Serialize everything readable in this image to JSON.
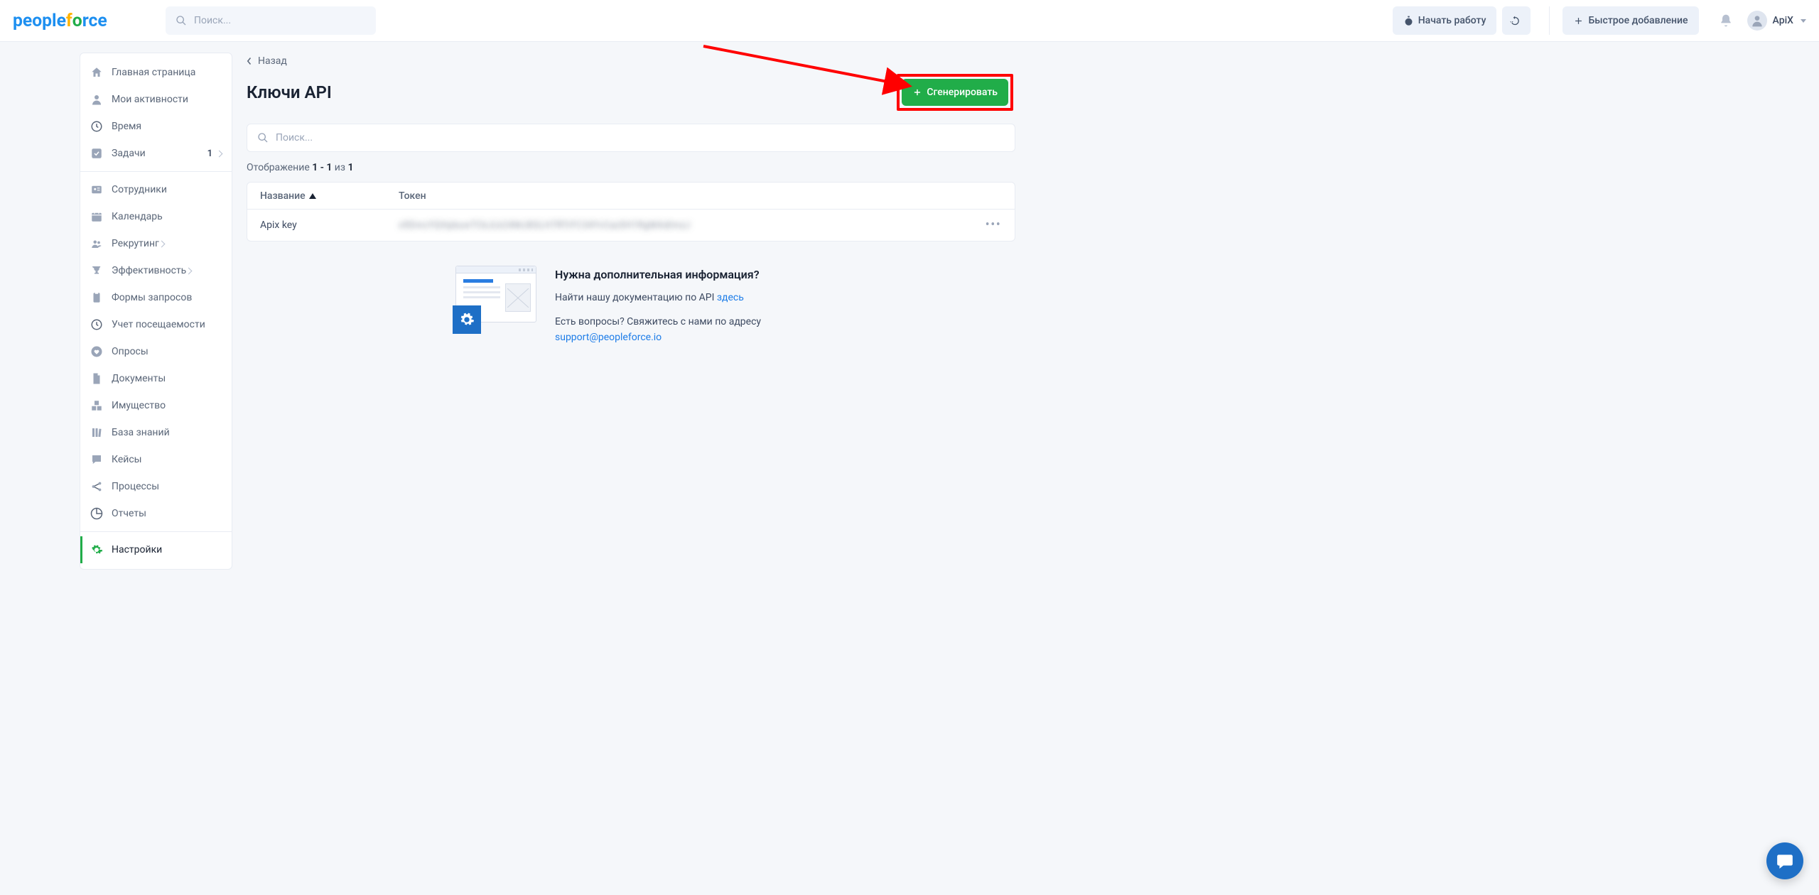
{
  "header": {
    "search_placeholder": "Поиск...",
    "start_label": "Начать работу",
    "quickadd_label": "Быстрое добавление",
    "username": "ApiX"
  },
  "sidebar": {
    "items": [
      {
        "label": "Главная страница",
        "icon": "home"
      },
      {
        "label": "Мои активности",
        "icon": "user"
      },
      {
        "label": "Время",
        "icon": "clock"
      },
      {
        "label": "Задачи",
        "icon": "check",
        "badge": "1",
        "chev": true
      },
      {
        "hr": true
      },
      {
        "label": "Сотрудники",
        "icon": "idcard"
      },
      {
        "label": "Календарь",
        "icon": "calendar"
      },
      {
        "label": "Рекрутинг",
        "icon": "people",
        "chev": true
      },
      {
        "label": "Эффективность",
        "icon": "trophy",
        "chev": true
      },
      {
        "label": "Формы запросов",
        "icon": "clip"
      },
      {
        "label": "Учет посещаемости",
        "icon": "clock"
      },
      {
        "label": "Опросы",
        "icon": "heart"
      },
      {
        "label": "Документы",
        "icon": "doc"
      },
      {
        "label": "Имущество",
        "icon": "boxes"
      },
      {
        "label": "База знаний",
        "icon": "books"
      },
      {
        "label": "Кейсы",
        "icon": "chat"
      },
      {
        "label": "Процессы",
        "icon": "share"
      },
      {
        "label": "Отчеты",
        "icon": "pie"
      },
      {
        "hr": true
      },
      {
        "label": "Настройки",
        "icon": "gear",
        "active": true
      }
    ]
  },
  "main": {
    "back": "Назад",
    "title": "Ключи API",
    "generate": "Сгенерировать",
    "search_placeholder": "Поиск...",
    "count_prefix": "Отображение ",
    "count_range": "1 - 1",
    "count_mid": " из ",
    "count_total": "1",
    "col_name": "Название",
    "col_token": "Токен",
    "row": {
      "name": "Apix key",
      "token": "x9DmcYQHpbuwTCkJLk24MJ8GLH7RTrFC34YvCazSH1RgMAdImzJ"
    }
  },
  "info": {
    "heading": "Нужна дополнительная информация?",
    "line1_a": "Найти нашу документацию по API ",
    "line1_link": "здесь",
    "line2": "Есть вопросы? Свяжитесь с нами по адресу",
    "email": "support@peopleforce.io"
  }
}
